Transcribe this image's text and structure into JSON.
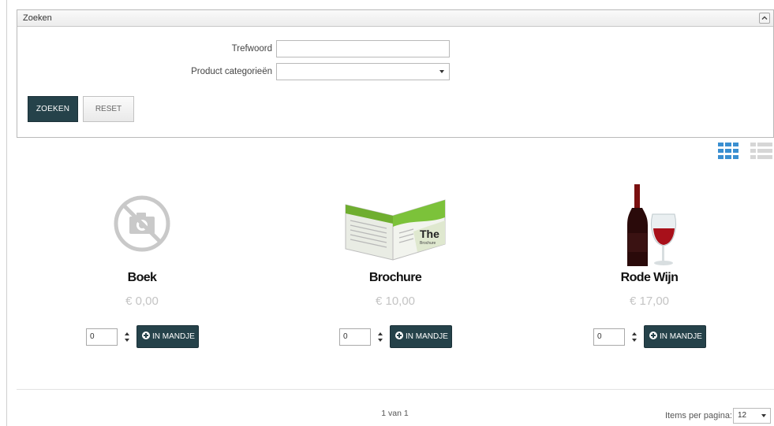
{
  "search_panel": {
    "title": "Zoeken",
    "keyword_label": "Trefwoord",
    "keyword_value": "",
    "category_label": "Product categorieën",
    "category_value": "",
    "search_button": "ZOEKEN",
    "reset_button": "RESET"
  },
  "view": {
    "grid_icon": "grid-view-icon",
    "list_icon": "list-view-icon",
    "active": "grid"
  },
  "products": [
    {
      "name": "Boek",
      "price": "€ 0,00",
      "quantity": "0",
      "add_label": "IN MANDJE",
      "image": "no-photo-icon"
    },
    {
      "name": "Brochure",
      "price": "€ 10,00",
      "quantity": "0",
      "add_label": "IN MANDJE",
      "image": "brochure-image"
    },
    {
      "name": "Rode Wijn",
      "price": "€ 17,00",
      "quantity": "0",
      "add_label": "IN MANDJE",
      "image": "red-wine-image"
    }
  ],
  "pagination": {
    "page_text": "1 van 1",
    "items_per_page_label": "Items per pagina:",
    "items_per_page_value": "12"
  },
  "colors": {
    "accent": "#25424a",
    "view_active": "#3a8fd1",
    "view_inactive": "#d6d6d6",
    "price": "#c4c4c4"
  }
}
